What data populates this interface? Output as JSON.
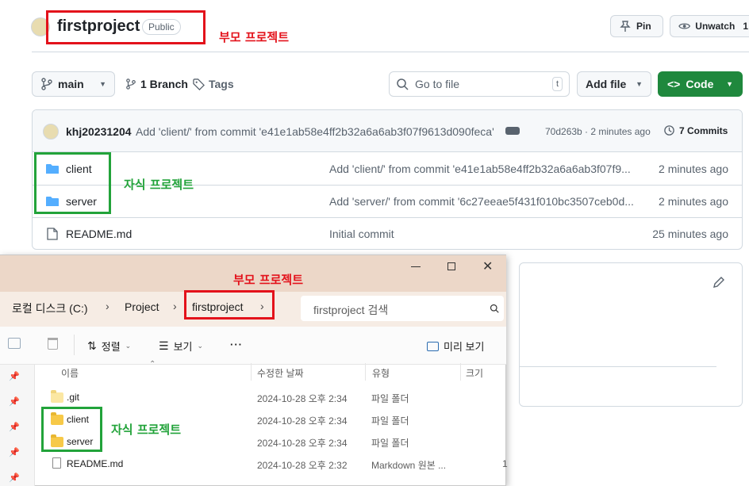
{
  "github": {
    "repo_name": "firstproject",
    "visibility_badge": "Public",
    "pin_label": "Pin",
    "watch_label": "Unwatch",
    "watch_count": "1",
    "branch_selector": "main",
    "branch_count": "1 Branch",
    "tags_label": "Tags",
    "search_placeholder": "Go to file",
    "search_shortcut": "t",
    "add_file_label": "Add file",
    "code_label": "Code",
    "commit": {
      "author": "khj20231204",
      "message": "Add 'client/' from commit 'e41e1ab58e4ff2b32a6a6ab3f07f9613d090feca'",
      "hash_time": "70d263b · 2 minutes ago",
      "commits_count": "7 Commits"
    },
    "files": [
      {
        "name": "client",
        "message": "Add 'client/' from commit 'e41e1ab58e4ff2b32a6a6ab3f07f9...",
        "time": "2 minutes ago"
      },
      {
        "name": "server",
        "message": "Add 'server/' from commit '6c27eeae5f431f010bc3507ceb0d...",
        "time": "2 minutes ago"
      },
      {
        "name": "README.md",
        "message": "Initial commit",
        "time": "25 minutes ago"
      }
    ]
  },
  "annotations": {
    "parent_label_top": "부모 프로젝트",
    "child_label_top": "자식 프로젝트",
    "parent_label_explorer": "부모 프로젝트",
    "child_label_explorer": "자식 프로젝트"
  },
  "explorer": {
    "breadcrumbs": [
      "로컬 디스크 (C:)",
      "Project",
      "firstproject"
    ],
    "search_placeholder": "firstproject 검색",
    "toolbar": {
      "sort": "정렬",
      "view": "보기",
      "more": "···",
      "preview": "미리 보기"
    },
    "columns": {
      "name": "이름",
      "modified": "수정한 날짜",
      "type": "유형",
      "size": "크기"
    },
    "rows": [
      {
        "name": ".git",
        "modified": "2024-10-28 오후 2:34",
        "type": "파일 폴더",
        "size": ""
      },
      {
        "name": "client",
        "modified": "2024-10-28 오후 2:34",
        "type": "파일 폴더",
        "size": ""
      },
      {
        "name": "server",
        "modified": "2024-10-28 오후 2:34",
        "type": "파일 폴더",
        "size": ""
      },
      {
        "name": "README.md",
        "modified": "2024-10-28 오후 2:32",
        "type": "Markdown 원본 ...",
        "size": "1"
      }
    ]
  },
  "colors": {
    "code_button": "#1f883d",
    "annotation_red": "#e3121b",
    "annotation_green": "#22a33a",
    "titlebar": "#ecd7c8"
  }
}
